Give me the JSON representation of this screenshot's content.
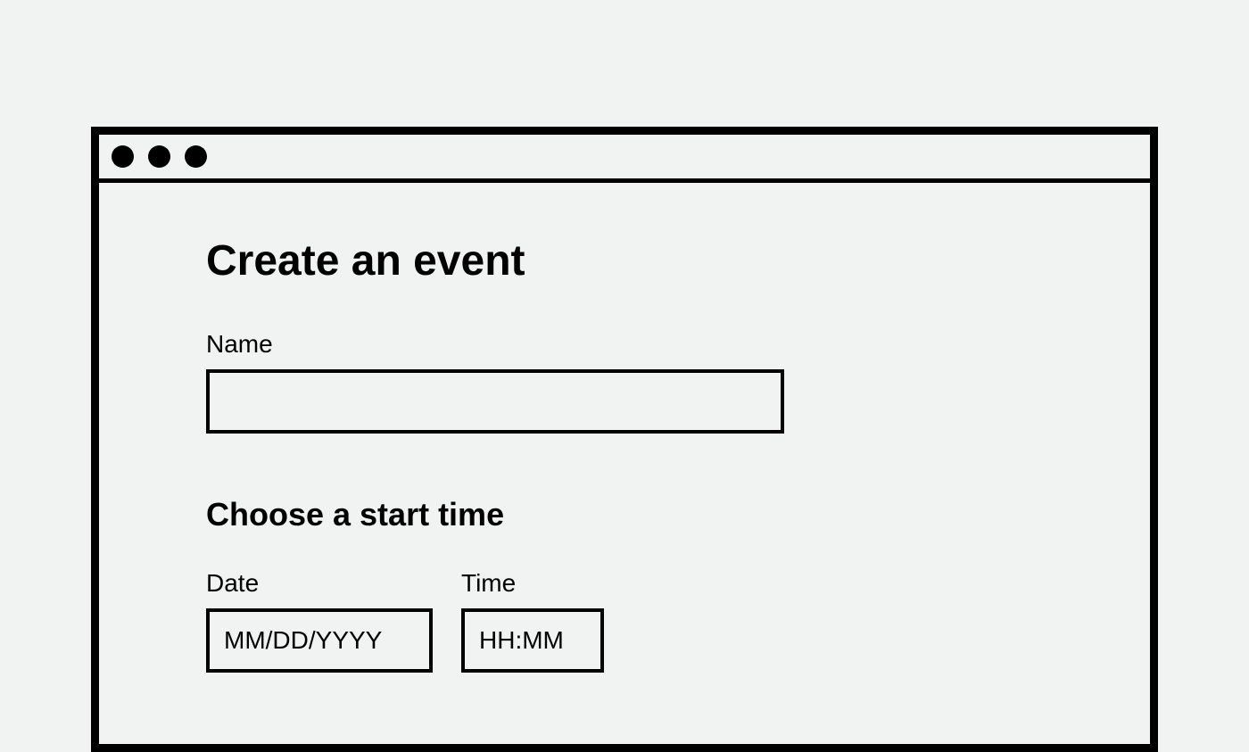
{
  "form": {
    "title": "Create an event",
    "name_label": "Name",
    "name_value": "",
    "section_heading": "Choose a start time",
    "date_label": "Date",
    "date_placeholder": "MM/DD/YYYY",
    "date_value": "",
    "time_label": "Time",
    "time_placeholder": "HH:MM",
    "time_value": ""
  }
}
